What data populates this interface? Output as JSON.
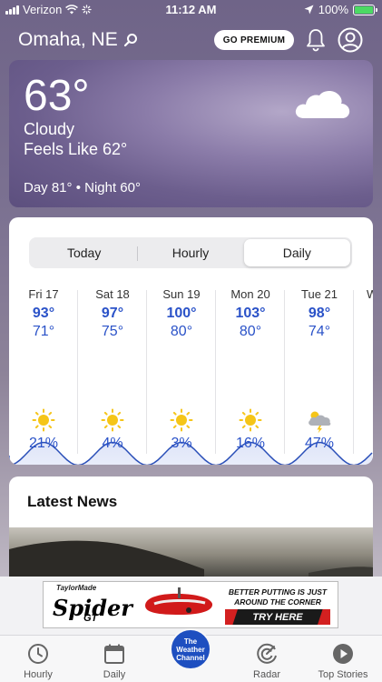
{
  "status_bar": {
    "carrier": "Verizon",
    "time": "11:12 AM",
    "battery": "100%",
    "battery_level": 1.0
  },
  "header": {
    "location": "Omaha, NE",
    "premium_label": "GO PREMIUM"
  },
  "current": {
    "temp": "63°",
    "condition": "Cloudy",
    "feels_like": "Feels Like 62°",
    "day_night": "Day 81° • Night 60°",
    "icon": "cloud-icon"
  },
  "forecast": {
    "tabs": [
      "Today",
      "Hourly",
      "Daily"
    ],
    "active_tab": "Daily",
    "days": [
      {
        "name": "Fri 17",
        "hi": "93°",
        "lo": "71°",
        "icon": "sun-icon",
        "precip": "21%"
      },
      {
        "name": "Sat 18",
        "hi": "97°",
        "lo": "75°",
        "icon": "sun-icon",
        "precip": "4%"
      },
      {
        "name": "Sun 19",
        "hi": "100°",
        "lo": "80°",
        "icon": "sun-icon",
        "precip": "3%"
      },
      {
        "name": "Mon 20",
        "hi": "103°",
        "lo": "80°",
        "icon": "sun-icon",
        "precip": "16%"
      },
      {
        "name": "Tue 21",
        "hi": "98°",
        "lo": "74°",
        "icon": "thunderstorm-icon",
        "precip": "47%"
      },
      {
        "name": "W",
        "hi": "",
        "lo": "",
        "icon": "",
        "precip": ""
      }
    ]
  },
  "news": {
    "title": "Latest News"
  },
  "ad": {
    "brand": "TaylorMade",
    "product": "Spider",
    "product_sub": "GT",
    "line1": "BETTER PUTTING IS JUST",
    "line2": "AROUND THE CORNER",
    "cta": "TRY HERE"
  },
  "tabbar": {
    "items": [
      {
        "label": "Hourly",
        "icon": "clock-icon"
      },
      {
        "label": "Daily",
        "icon": "calendar-icon"
      },
      {
        "label": "",
        "icon": "weather-channel-logo"
      },
      {
        "label": "Radar",
        "icon": "radar-icon"
      },
      {
        "label": "Top Stories",
        "icon": "play-icon"
      }
    ],
    "logo_text": "The Weather Channel"
  },
  "colors": {
    "accent_blue": "#2a52c8",
    "sun_yellow": "#f5c518",
    "logo_blue": "#1e4fc0"
  }
}
